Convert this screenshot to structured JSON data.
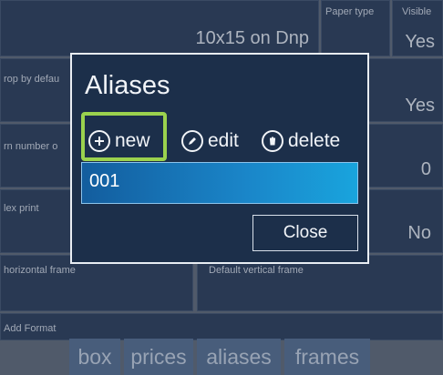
{
  "background": {
    "paper_type_label": "Paper type",
    "visible_label": "Visible",
    "format_value": "10x15 on Dnp",
    "visible_value_1": "Yes",
    "crop_label": "rop by defau",
    "crop_value": "Yes",
    "number_label": "rn number o",
    "number_value": "0",
    "index_label": "lex print",
    "index_value": "No",
    "horizontal_frame_label": "horizontal frame",
    "vertical_frame_label": "Default vertical frame",
    "add_format_label": "Add Format"
  },
  "dialog": {
    "title": "Aliases",
    "actions": {
      "new": "new",
      "edit": "edit",
      "delete": "delete"
    },
    "items": [
      "001"
    ],
    "close_label": "Close"
  },
  "bottom_bar": {
    "box": "box",
    "prices": "prices",
    "aliases": "aliases",
    "frames": "frames"
  },
  "colors": {
    "highlight": "#9bd24e",
    "selected_row": "#1a86c9",
    "dialog_bg": "#1c2f4a"
  }
}
